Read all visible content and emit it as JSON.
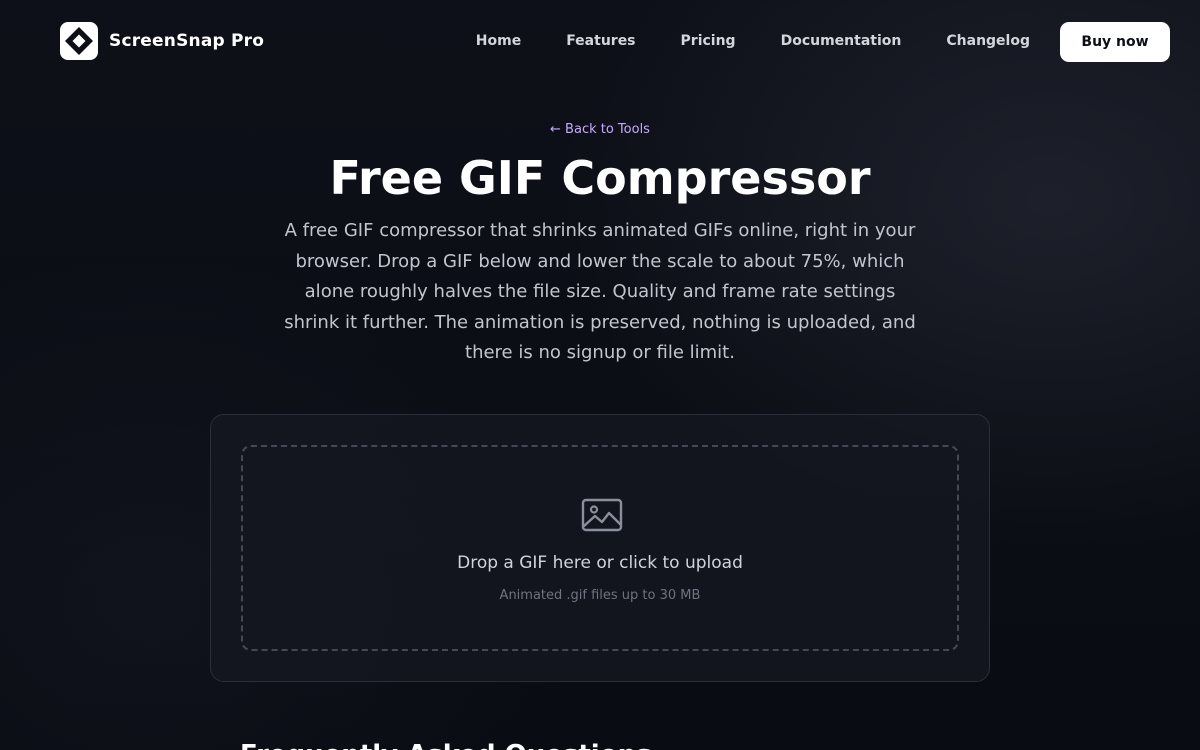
{
  "brand": {
    "name": "ScreenSnap Pro",
    "logo_icon": "diamond-logo-icon"
  },
  "nav": {
    "items": [
      {
        "label": "Home"
      },
      {
        "label": "Features"
      },
      {
        "label": "Pricing"
      },
      {
        "label": "Documentation"
      },
      {
        "label": "Changelog"
      }
    ],
    "buy_label": "Buy now"
  },
  "hero": {
    "back_link": "← Back to Tools",
    "title": "Free GIF Compressor",
    "description": "A free GIF compressor that shrinks animated GIFs online, right in your browser. Drop a GIF below and lower the scale to about 75%, which alone roughly halves the file size. Quality and frame rate settings shrink it further. The animation is preserved, nothing is uploaded, and there is no signup or file limit."
  },
  "uploader": {
    "icon": "image-icon",
    "title": "Drop a GIF here or click to upload",
    "subtitle": "Animated .gif files up to 30 MB"
  },
  "faq": {
    "heading": "Frequently Asked Questions"
  },
  "colors": {
    "background": "#0d0f17",
    "accent_link": "#c6a8ff",
    "button_bg": "#ffffff"
  }
}
